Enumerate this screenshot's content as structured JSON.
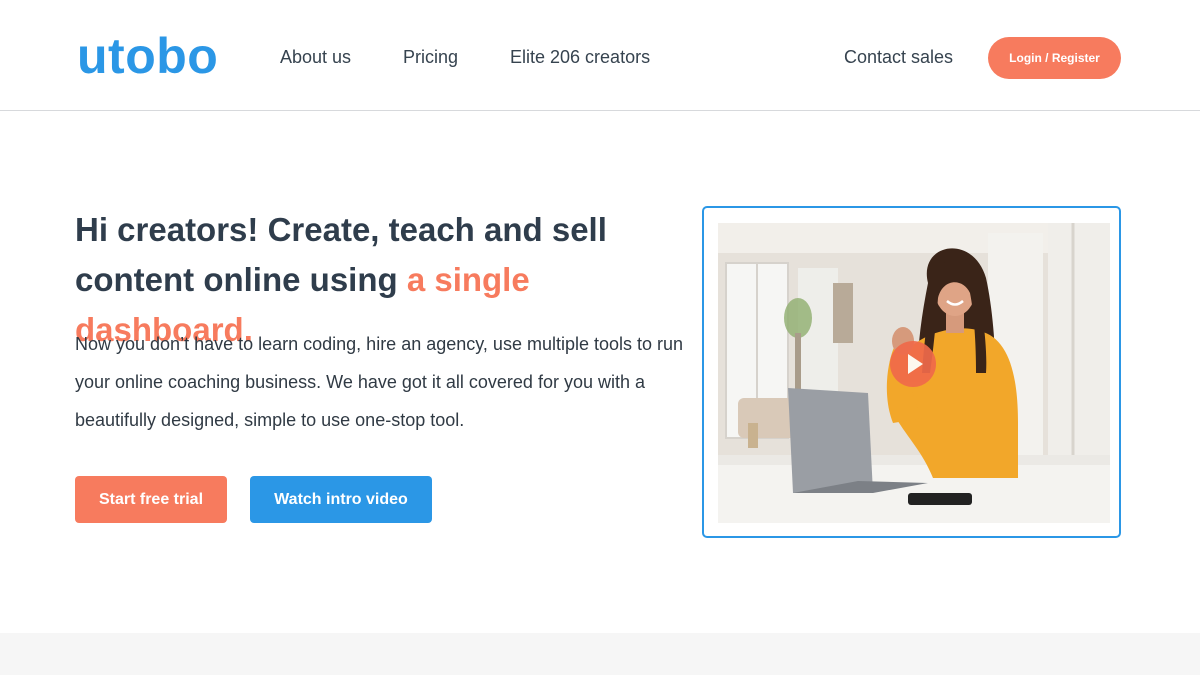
{
  "header": {
    "logo": "utobo",
    "nav": {
      "about": "About us",
      "pricing": "Pricing",
      "elite": "Elite 206 creators",
      "contact": "Contact sales"
    },
    "login_label": "Login / Register"
  },
  "hero": {
    "headline_line1": "Hi creators! Create, teach and sell",
    "headline_line2_prefix": "content online using ",
    "headline_accent": "a single dashboard.",
    "subtext": "Now you don’t have to learn coding, hire an agency, use multiple tools to run your online coaching business. We have got it all covered for you with a beautifully designed, simple to use one-stop tool.",
    "primary_button": "Start free trial",
    "secondary_button": "Watch intro video"
  },
  "colors": {
    "brand_blue": "#2b97e6",
    "accent_coral": "#f77b5e",
    "text_dark": "#2f3d4c"
  },
  "icons": {
    "play": "play-icon"
  }
}
